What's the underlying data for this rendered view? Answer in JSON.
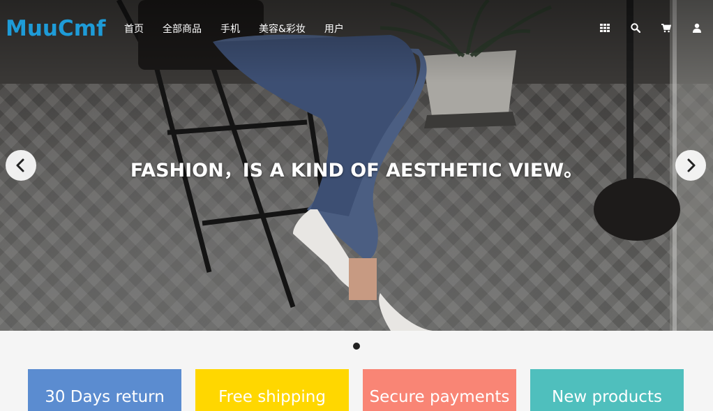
{
  "header": {
    "logo": "MuuCmf",
    "nav": [
      "首页",
      "全部商品",
      "手机",
      "美容&彩妆",
      "用户"
    ],
    "icons": [
      "grid-icon",
      "search-icon",
      "cart-icon",
      "user-icon"
    ]
  },
  "slider": {
    "caption": "FASHION，IS A KIND OF AESTHETIC VIEW。",
    "active_index": 0,
    "slide_count": 1
  },
  "features": [
    {
      "label": "30 Days return",
      "color": "#5b8cd0"
    },
    {
      "label": "Free shipping",
      "color": "#ffd700"
    },
    {
      "label": "Secure payments",
      "color": "#f98575"
    },
    {
      "label": "New products",
      "color": "#4fbfbd"
    }
  ],
  "colors": {
    "logo": "#1e9bd7",
    "page_background": "#f5f5f5"
  }
}
